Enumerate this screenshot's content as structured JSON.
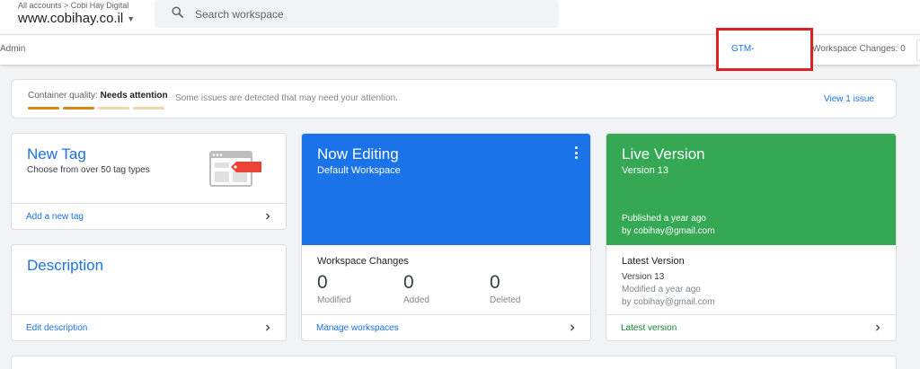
{
  "header": {
    "breadcrumb": "All accounts > Cobi Hay Digital",
    "account_name": "www.cobihay.co.il",
    "search_placeholder": "Search workspace"
  },
  "subbar": {
    "admin_label": "Admin",
    "container_id": "GTM-",
    "workspace_changes": "Workspace Changes: 0"
  },
  "quality": {
    "label": "Container quality:",
    "status": "Needs attention",
    "message": "Some issues are detected that may need your attention.",
    "link": "View 1 issue",
    "bar_colors": [
      "#d9861c",
      "#d9861c",
      "#f3d3a8",
      "#f3d3a8"
    ]
  },
  "new_tag": {
    "title": "New Tag",
    "subtitle": "Choose from over 50 tag types",
    "footer": "Add a new tag"
  },
  "description": {
    "title": "Description",
    "footer": "Edit description"
  },
  "now_editing": {
    "title": "Now Editing",
    "subtitle": "Default Workspace",
    "changes_heading": "Workspace Changes",
    "stats": [
      {
        "value": "0",
        "label": "Modified"
      },
      {
        "value": "0",
        "label": "Added"
      },
      {
        "value": "0",
        "label": "Deleted"
      }
    ],
    "footer": "Manage workspaces"
  },
  "live_version": {
    "title": "Live Version",
    "subtitle": "Version 13",
    "published": "Published a year ago",
    "by": "by cobihay@gmail.com",
    "latest_heading": "Latest Version",
    "latest_version": "Version 13",
    "modified": "Modified a year ago",
    "modified_by": "by cobihay@gmail.com",
    "footer": "Latest version"
  },
  "colors": {
    "accent": "#1a73e8",
    "editing_bg": "#1a73e8",
    "live_bg": "#34a853",
    "live_link": "#188038",
    "highlight_box": "#e02020"
  }
}
